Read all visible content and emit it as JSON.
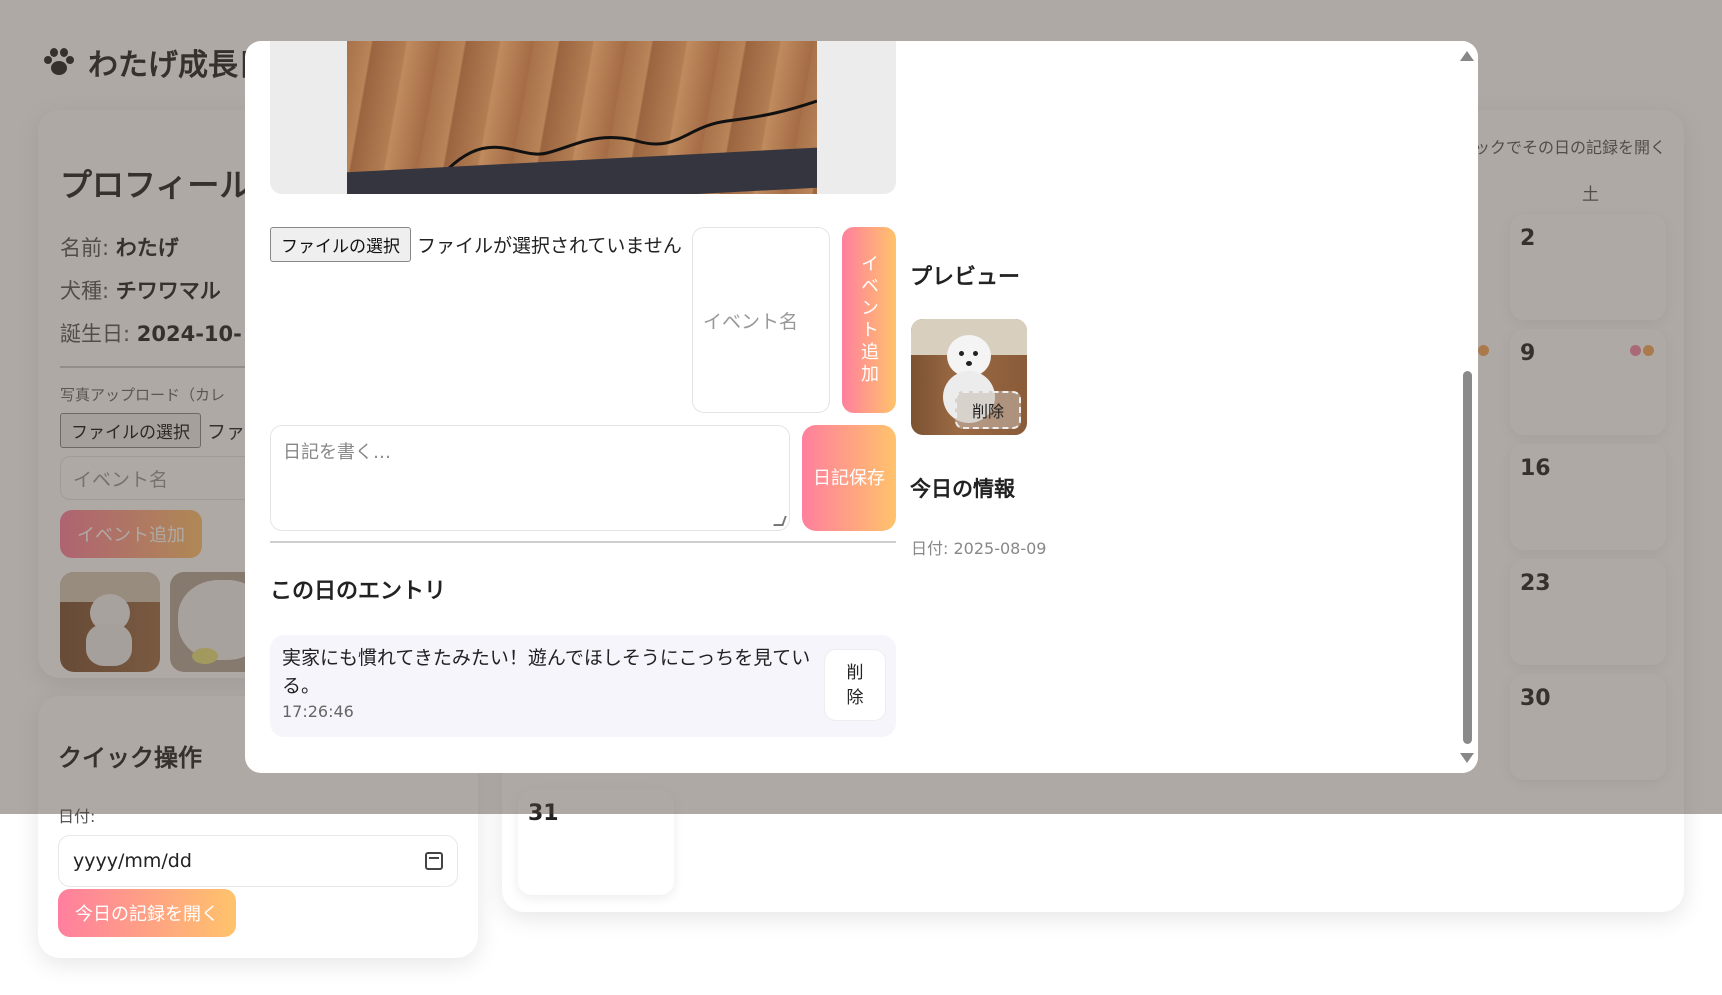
{
  "app": {
    "title": "わたげ成長日記"
  },
  "profile": {
    "heading": "プロフィール",
    "name_label": "名前:",
    "name_value": "わたげ",
    "breed_label": "犬種:",
    "breed_value": "チワワマル",
    "birthday_label": "誕生日:",
    "birthday_value": "2024-10-",
    "upload_label": "写真アップロード（カレ",
    "file_button": "ファイルの選択",
    "file_status": "ファ",
    "event_placeholder": "イベント名",
    "add_event_button": "イベント追加"
  },
  "quick": {
    "heading": "クイック操作",
    "date_label": "日付:",
    "date_placeholder": "yyyy/mm/dd",
    "open_button": "今日の記録を開く"
  },
  "calendar": {
    "hint": "ックでその日の記録を開く",
    "saturday_label": "土",
    "days": [
      {
        "day": "2"
      },
      {
        "day": "9"
      },
      {
        "day": "16"
      },
      {
        "day": "23"
      },
      {
        "day": "30"
      },
      {
        "day": "31"
      }
    ]
  },
  "modal": {
    "file_button": "ファイルの選択",
    "file_status": "ファイルが選択されていません",
    "event_placeholder": "イベント名",
    "add_event_button": "イベント追加",
    "diary_placeholder": "日記を書く…",
    "save_diary_button": "日記保存",
    "entries_heading": "この日のエントリ",
    "entries": [
      {
        "text": "実家にも慣れてきたみたい！遊んでほしそうにこっちを見ている。",
        "time": "17:26:46",
        "delete_label": "削除"
      }
    ],
    "preview_heading": "プレビュー",
    "preview_delete": "削除",
    "today_heading": "今日の情報",
    "date_label": "日付:",
    "date_value": "2025-08-09"
  },
  "colors": {
    "gradient_start": "#ff7f9e",
    "gradient_end": "#ffc36b",
    "dot_pink": "#f48aa6",
    "dot_orange": "#f5a85a"
  }
}
